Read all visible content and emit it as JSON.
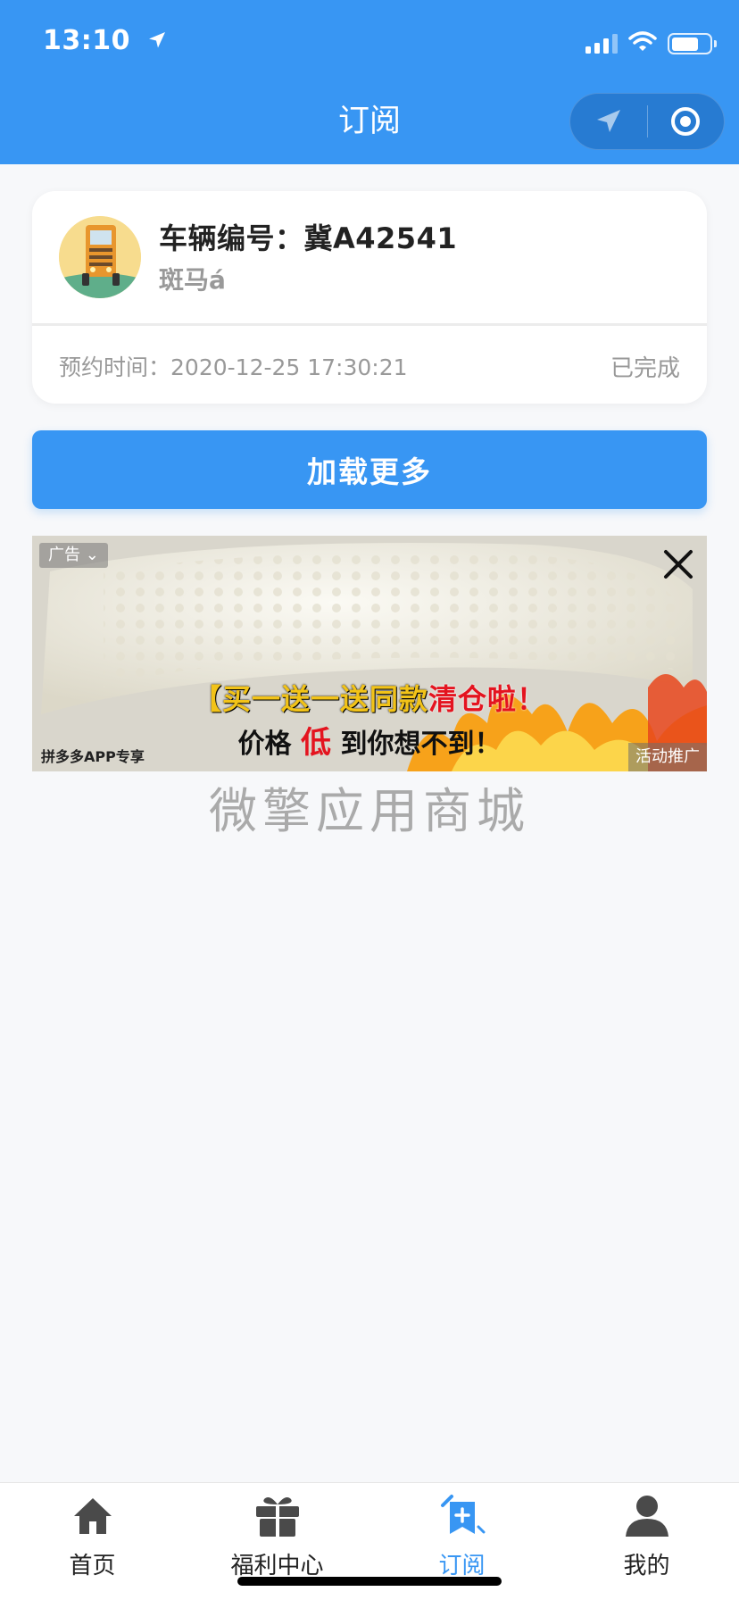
{
  "status_bar": {
    "time": "13:10",
    "location_icon": "location-arrow-icon",
    "signal_icon": "cellular-signal-icon",
    "wifi_icon": "wifi-icon",
    "battery_icon": "battery-icon",
    "battery_level": 0.72
  },
  "nav": {
    "title": "订阅",
    "capsule_left_icon": "location-arrow-icon",
    "capsule_right_icon": "record-circle-icon"
  },
  "record": {
    "avatar_icon": "truck-avatar-icon",
    "vehicle_label": "车辆编号：冀A42541",
    "driver_name": "斑马á",
    "appointment_label": "预约时间：",
    "appointment_time": "2020-12-25 17:30:21",
    "status": "已完成"
  },
  "load_more_label": "加载更多",
  "ad": {
    "tag_label": "广告",
    "close_icon": "close-icon",
    "headline_yellow": "【买一送一送同款",
    "headline_red": "清仓啦！",
    "subline_prefix": "价格",
    "subline_red": "低",
    "subline_suffix": "到你想不到！",
    "footer_left": "拼多多APP专享",
    "footer_right": "活动推广"
  },
  "watermark": "微擎应用商城",
  "tabbar": {
    "items": [
      {
        "label": "首页",
        "icon": "home-icon",
        "active": false
      },
      {
        "label": "福利中心",
        "icon": "gift-icon",
        "active": false
      },
      {
        "label": "订阅",
        "icon": "bookmark-add-icon",
        "active": true
      },
      {
        "label": "我的",
        "icon": "user-icon",
        "active": false
      }
    ]
  },
  "colors": {
    "primary": "#3896f3",
    "background": "#f7f8fa",
    "muted_text": "#999999",
    "ad_red": "#e4141f",
    "ad_yellow": "#f2c318"
  }
}
